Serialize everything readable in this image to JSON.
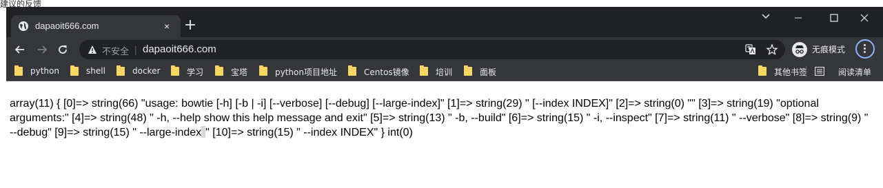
{
  "background": {
    "partial_text": "建议的反馈"
  },
  "tab": {
    "title": "dapaoit666.com",
    "close": "×"
  },
  "omnibox": {
    "security_label": "不安全",
    "separator": "|",
    "url": "dapaoit666.com"
  },
  "profile": {
    "label": "无痕模式"
  },
  "bookmarks": {
    "items": [
      {
        "label": "python"
      },
      {
        "label": "shell"
      },
      {
        "label": "docker"
      },
      {
        "label": "学习"
      },
      {
        "label": "宝塔"
      },
      {
        "label": "python项目地址"
      },
      {
        "label": "Centos镜像"
      },
      {
        "label": "培训"
      },
      {
        "label": "面板"
      }
    ],
    "other": "其他书签",
    "reading_list": "阅读清单"
  },
  "page": {
    "text_part1": "array(11) { [0]=> string(66) \"usage: bowtie [-h] [-b | -i] [--verbose] [--debug] [--large-index]\" [1]=> string(29) \" [--index INDEX]\" [2]=> string(0) \"\" [3]=> string(19) \"optional arguments:\" [4]=> string(48) \" -h, --help show this help message and exit\" [5]=> string(13) \" -b, --build\" [6]=> string(15) \" -i, --inspect\" [7]=> string(11) \" --verbose\" [8]=> string(9) \" --debug\" [9]=> string(15) \" --large-index",
    "text_part2": "\" [10]=> string(15) \" --index INDEX\" } int(0)"
  },
  "colors": {
    "titlebar": "#202124",
    "toolbar": "#35363a",
    "accent": "#8ab4f8",
    "folder": "#fcd663"
  }
}
